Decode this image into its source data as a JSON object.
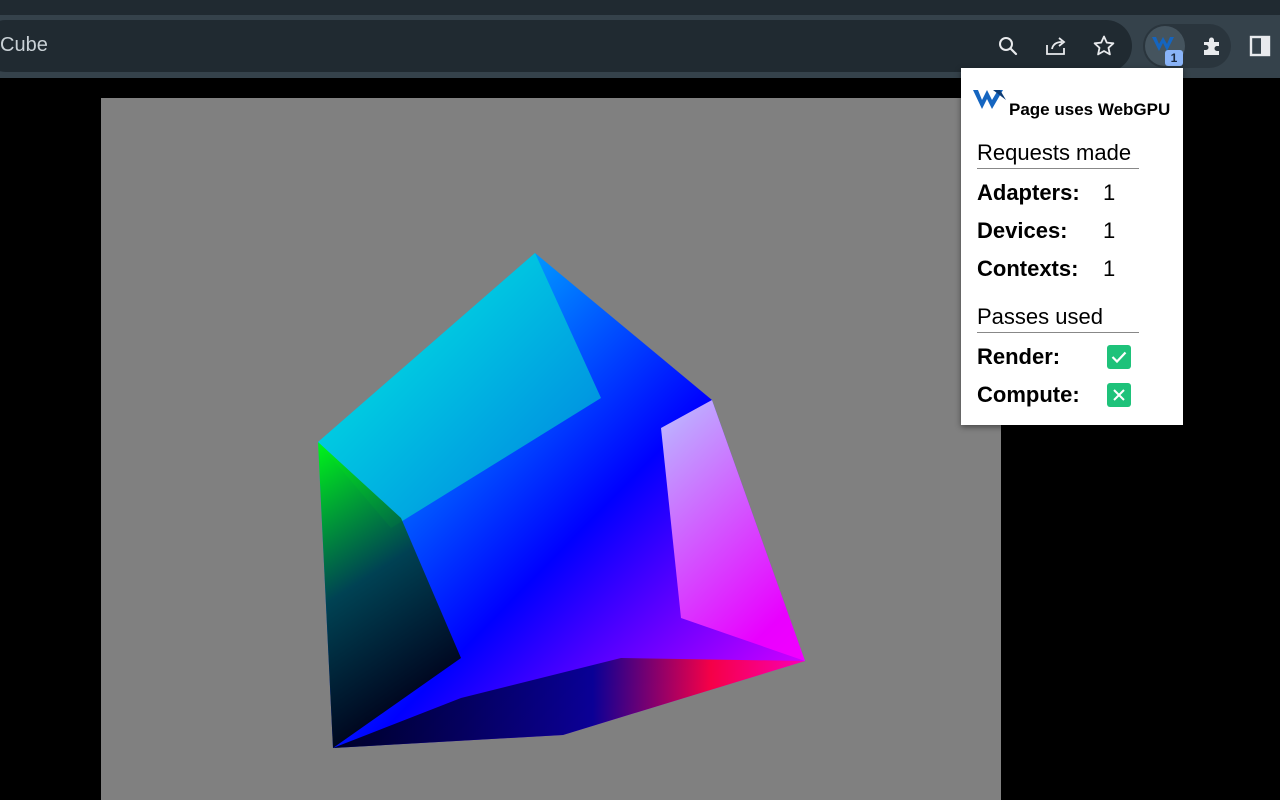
{
  "browser": {
    "address_text": "Cube",
    "toolbar_icons": [
      "search-icon",
      "share-icon",
      "star-icon",
      "webgpu-extension-icon",
      "puzzle-icon",
      "side-panel-icon"
    ],
    "extension_badge": "1",
    "colors": {
      "toolbar": "#35424b",
      "omnibox": "#202a31",
      "badge": "#8ab4f8"
    }
  },
  "canvas": {
    "background": "#808080"
  },
  "popup": {
    "title": "Page uses WebGPU",
    "requests_heading": "Requests made",
    "requests": [
      {
        "label": "Adapters:",
        "value": "1"
      },
      {
        "label": "Devices:",
        "value": "1"
      },
      {
        "label": "Contexts:",
        "value": "1"
      }
    ],
    "passes_heading": "Passes used",
    "passes": [
      {
        "label": "Render:",
        "state": "check"
      },
      {
        "label": "Compute:",
        "state": "cross"
      }
    ],
    "check_color": "#1ec27a",
    "logo_color": "#1565c0"
  }
}
